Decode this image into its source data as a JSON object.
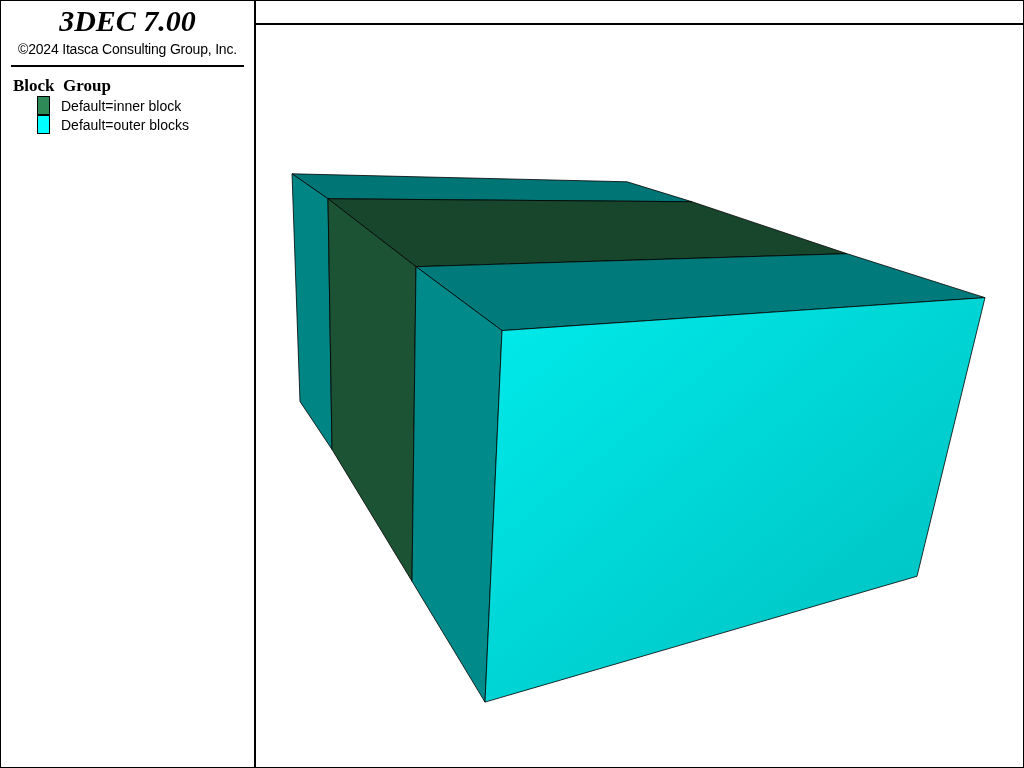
{
  "title": "3DEC 7.00",
  "copyright": "©2024 Itasca Consulting Group, Inc.",
  "legend": {
    "title": "Block  Group",
    "items": [
      {
        "label": "Default=inner block",
        "color": "#2e8b57"
      },
      {
        "label": "Default=outer blocks",
        "color": "#00ffff"
      }
    ]
  }
}
